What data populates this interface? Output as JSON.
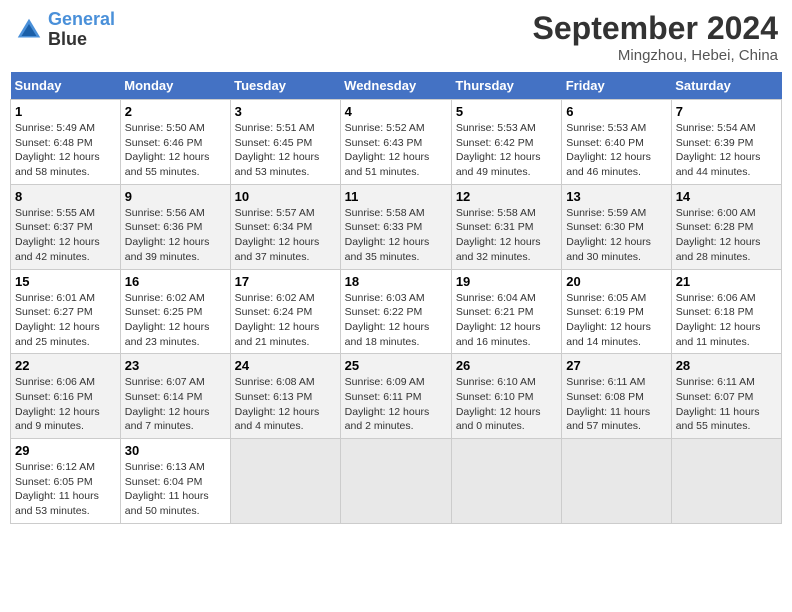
{
  "header": {
    "logo_line1": "General",
    "logo_line2": "Blue",
    "month": "September 2024",
    "location": "Mingzhou, Hebei, China"
  },
  "weekdays": [
    "Sunday",
    "Monday",
    "Tuesday",
    "Wednesday",
    "Thursday",
    "Friday",
    "Saturday"
  ],
  "weeks": [
    [
      {
        "day": 1,
        "sunrise": "5:49 AM",
        "sunset": "6:48 PM",
        "daylight": "12 hours and 58 minutes."
      },
      {
        "day": 2,
        "sunrise": "5:50 AM",
        "sunset": "6:46 PM",
        "daylight": "12 hours and 55 minutes."
      },
      {
        "day": 3,
        "sunrise": "5:51 AM",
        "sunset": "6:45 PM",
        "daylight": "12 hours and 53 minutes."
      },
      {
        "day": 4,
        "sunrise": "5:52 AM",
        "sunset": "6:43 PM",
        "daylight": "12 hours and 51 minutes."
      },
      {
        "day": 5,
        "sunrise": "5:53 AM",
        "sunset": "6:42 PM",
        "daylight": "12 hours and 49 minutes."
      },
      {
        "day": 6,
        "sunrise": "5:53 AM",
        "sunset": "6:40 PM",
        "daylight": "12 hours and 46 minutes."
      },
      {
        "day": 7,
        "sunrise": "5:54 AM",
        "sunset": "6:39 PM",
        "daylight": "12 hours and 44 minutes."
      }
    ],
    [
      {
        "day": 8,
        "sunrise": "5:55 AM",
        "sunset": "6:37 PM",
        "daylight": "12 hours and 42 minutes."
      },
      {
        "day": 9,
        "sunrise": "5:56 AM",
        "sunset": "6:36 PM",
        "daylight": "12 hours and 39 minutes."
      },
      {
        "day": 10,
        "sunrise": "5:57 AM",
        "sunset": "6:34 PM",
        "daylight": "12 hours and 37 minutes."
      },
      {
        "day": 11,
        "sunrise": "5:58 AM",
        "sunset": "6:33 PM",
        "daylight": "12 hours and 35 minutes."
      },
      {
        "day": 12,
        "sunrise": "5:58 AM",
        "sunset": "6:31 PM",
        "daylight": "12 hours and 32 minutes."
      },
      {
        "day": 13,
        "sunrise": "5:59 AM",
        "sunset": "6:30 PM",
        "daylight": "12 hours and 30 minutes."
      },
      {
        "day": 14,
        "sunrise": "6:00 AM",
        "sunset": "6:28 PM",
        "daylight": "12 hours and 28 minutes."
      }
    ],
    [
      {
        "day": 15,
        "sunrise": "6:01 AM",
        "sunset": "6:27 PM",
        "daylight": "12 hours and 25 minutes."
      },
      {
        "day": 16,
        "sunrise": "6:02 AM",
        "sunset": "6:25 PM",
        "daylight": "12 hours and 23 minutes."
      },
      {
        "day": 17,
        "sunrise": "6:02 AM",
        "sunset": "6:24 PM",
        "daylight": "12 hours and 21 minutes."
      },
      {
        "day": 18,
        "sunrise": "6:03 AM",
        "sunset": "6:22 PM",
        "daylight": "12 hours and 18 minutes."
      },
      {
        "day": 19,
        "sunrise": "6:04 AM",
        "sunset": "6:21 PM",
        "daylight": "12 hours and 16 minutes."
      },
      {
        "day": 20,
        "sunrise": "6:05 AM",
        "sunset": "6:19 PM",
        "daylight": "12 hours and 14 minutes."
      },
      {
        "day": 21,
        "sunrise": "6:06 AM",
        "sunset": "6:18 PM",
        "daylight": "12 hours and 11 minutes."
      }
    ],
    [
      {
        "day": 22,
        "sunrise": "6:06 AM",
        "sunset": "6:16 PM",
        "daylight": "12 hours and 9 minutes."
      },
      {
        "day": 23,
        "sunrise": "6:07 AM",
        "sunset": "6:14 PM",
        "daylight": "12 hours and 7 minutes."
      },
      {
        "day": 24,
        "sunrise": "6:08 AM",
        "sunset": "6:13 PM",
        "daylight": "12 hours and 4 minutes."
      },
      {
        "day": 25,
        "sunrise": "6:09 AM",
        "sunset": "6:11 PM",
        "daylight": "12 hours and 2 minutes."
      },
      {
        "day": 26,
        "sunrise": "6:10 AM",
        "sunset": "6:10 PM",
        "daylight": "12 hours and 0 minutes."
      },
      {
        "day": 27,
        "sunrise": "6:11 AM",
        "sunset": "6:08 PM",
        "daylight": "11 hours and 57 minutes."
      },
      {
        "day": 28,
        "sunrise": "6:11 AM",
        "sunset": "6:07 PM",
        "daylight": "11 hours and 55 minutes."
      }
    ],
    [
      {
        "day": 29,
        "sunrise": "6:12 AM",
        "sunset": "6:05 PM",
        "daylight": "11 hours and 53 minutes."
      },
      {
        "day": 30,
        "sunrise": "6:13 AM",
        "sunset": "6:04 PM",
        "daylight": "11 hours and 50 minutes."
      },
      null,
      null,
      null,
      null,
      null
    ]
  ]
}
